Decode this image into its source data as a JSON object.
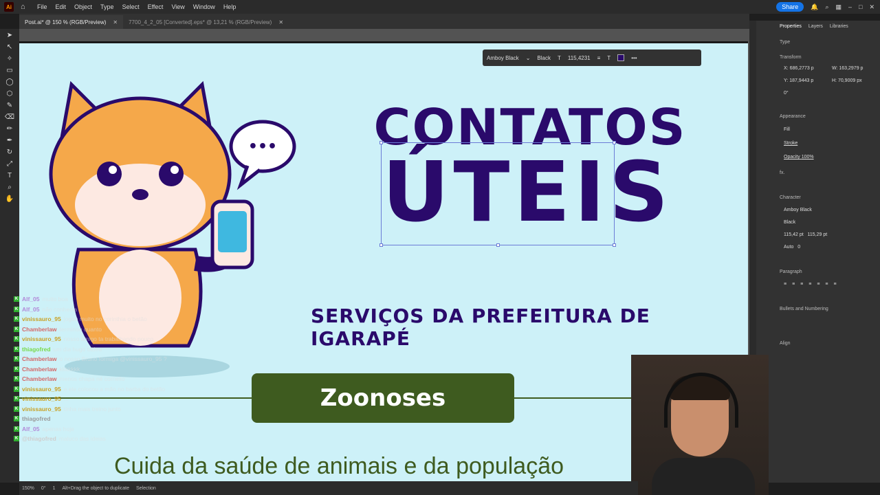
{
  "app": {
    "logo": "Ai",
    "home_icon": "home-icon"
  },
  "menu": [
    "File",
    "Edit",
    "Object",
    "Type",
    "Select",
    "Effect",
    "View",
    "Window",
    "Help"
  ],
  "topbar": {
    "share_label": "Share"
  },
  "tabs": [
    {
      "label": "Post.ai* @ 150 % (RGB/Preview)",
      "active": true
    },
    {
      "label": "7700_4_2_05 [Converted].eps* @ 13,21 % (RGB/Preview)",
      "active": false
    }
  ],
  "artboard": {
    "title_line1": "CONTATOS",
    "title_line2": "ÚTEIS",
    "subtitle": "SERVIÇOS DA PREFEITURA DE IGARAPÉ",
    "button_label": "Zoonoses",
    "bottom_text": "Cuida da saúde de animais e da população",
    "speech_dots": "•••",
    "title_color": "#2a0a6b",
    "button_color": "#3e5b1f"
  },
  "float_toolbar": {
    "font": "Amboy Black",
    "style": "Black",
    "size": "115,4231"
  },
  "panel": {
    "tabs": [
      "Properties",
      "Layers",
      "Libraries"
    ],
    "type_label": "Type",
    "transform_label": "Transform",
    "x_label": "X:",
    "x_value": "686,2773 p",
    "y_label": "Y:",
    "y_value": "187,9443 p",
    "w_label": "W:",
    "w_value": "163,2979 p",
    "h_label": "H:",
    "h_value": "70,9009 px",
    "rotate_value": "0°",
    "appearance_label": "Appearance",
    "fill_label": "Fill",
    "stroke_label": "Stroke",
    "opacity_label": "Opacity",
    "opacity_value": "100%",
    "fx_label": "fx.",
    "character_label": "Character",
    "font_family": "Amboy Black",
    "font_style": "Black",
    "font_size": "115,42 pt",
    "leading": "115,29 pt",
    "tracking_label": "Auto",
    "kerning_value": "0",
    "paragraph_label": "Paragraph",
    "bullets_label": "Bullets and Numbering",
    "align_label": "Align"
  },
  "chat": [
    {
      "user": "Alf_05",
      "color": "#b28ad9",
      "text": "muito boa"
    },
    {
      "user": "Alf_05",
      "color": "#b28ad9",
      "text": "não conhecia"
    },
    {
      "user": "vinissauro_95",
      "color": "#c9a227",
      "text": "jogou muito no corinthia o betão"
    },
    {
      "user": "Chamberlaw",
      "color": "#d46a6a",
      "text": "terminou quanto"
    },
    {
      "user": "vinissauro_95",
      "color": "#c9a227",
      "text": "nosso amigo ta trabalhando pouco"
    },
    {
      "user": "thiagofred",
      "color": "#7ad94a",
      "text": "um dia hugo tadeu"
    },
    {
      "user": "Chamberlaw",
      "color": "#d46a6a",
      "text": "o nosso Bruno formiga @vinissauro_95 ?"
    },
    {
      "user": "Chamberlaw",
      "color": "#d46a6a",
      "text": "kkkkkkk"
    },
    {
      "user": "Chamberlaw",
      "color": "#d46a6a",
      "text": "menos chapa né cornelio"
    },
    {
      "user": "vinissauro_95",
      "color": "#c9a227",
      "text": "e ele colocou a mão no barba do betão"
    },
    {
      "user": "vinissauro_95",
      "color": "#c9a227",
      "text": "..."
    },
    {
      "user": "vinissauro_95",
      "color": "#c9a227",
      "text": "tinha mais treino junto"
    },
    {
      "user": "thiagofred",
      "color": "#9a9a9a",
      "text": ""
    },
    {
      "user": "Alf_05",
      "color": "#b28ad9",
      "text": "apenas hoje"
    },
    {
      "user": "@thiagofred",
      "color": "#d0d0d0",
      "text": "maluco das ideias"
    }
  ],
  "status": {
    "zoom": "150%",
    "rotation": "0°",
    "artboard_num": "1",
    "hint": "Alt+Drag the object to duplicate",
    "mode": "Selection"
  }
}
